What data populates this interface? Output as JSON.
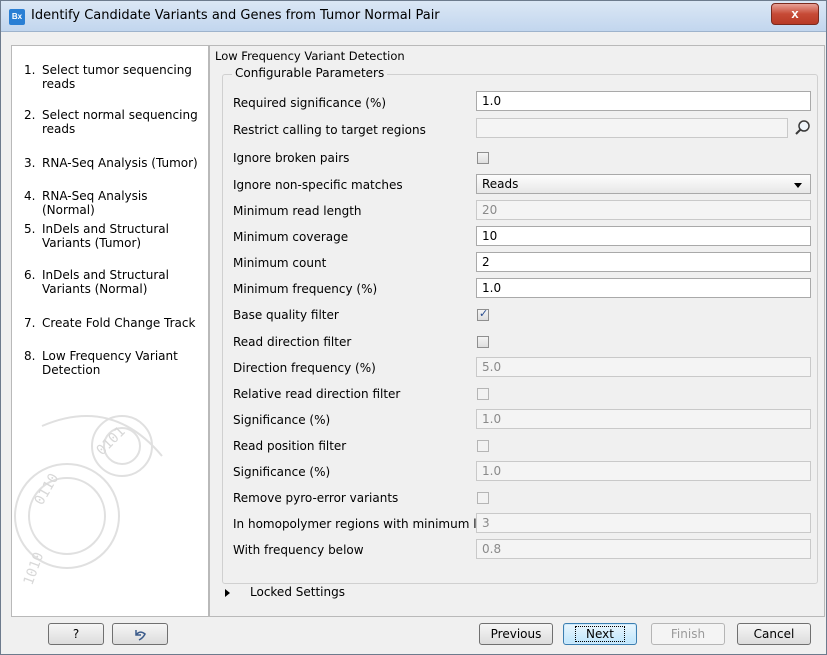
{
  "window": {
    "app_icon": "Bx",
    "title": "Identify Candidate Variants and Genes from Tumor Normal Pair",
    "close_label": "x"
  },
  "steps": [
    {
      "num": "1.",
      "label": "Select tumor sequencing reads"
    },
    {
      "num": "2.",
      "label": "Select normal sequencing reads"
    },
    {
      "num": "3.",
      "label": "RNA-Seq Analysis (Tumor)"
    },
    {
      "num": "4.",
      "label": "RNA-Seq Analysis (Normal)"
    },
    {
      "num": "5.",
      "label": "InDels and Structural Variants (Tumor)"
    },
    {
      "num": "6.",
      "label": "InDels and Structural Variants (Normal)"
    },
    {
      "num": "7.",
      "label": "Create Fold Change Track"
    },
    {
      "num": "8.",
      "label": "Low Frequency Variant Detection"
    }
  ],
  "panel": {
    "section_title": "Low Frequency Variant Detection",
    "group_title": "Configurable Parameters",
    "locked_settings": "Locked Settings",
    "params": {
      "required_significance": {
        "label": "Required significance (%)",
        "value": "1.0"
      },
      "restrict_calling": {
        "label": "Restrict calling to target regions",
        "value": ""
      },
      "ignore_broken_pairs": {
        "label": "Ignore broken pairs",
        "checked": false
      },
      "ignore_nonspecific": {
        "label": "Ignore non-specific matches",
        "value": "Reads"
      },
      "min_read_length": {
        "label": "Minimum read length",
        "value": "20"
      },
      "min_coverage": {
        "label": "Minimum coverage",
        "value": "10"
      },
      "min_count": {
        "label": "Minimum count",
        "value": "2"
      },
      "min_frequency": {
        "label": "Minimum frequency (%)",
        "value": "1.0"
      },
      "base_quality_filter": {
        "label": "Base quality filter",
        "checked": true
      },
      "read_direction_filter": {
        "label": "Read direction filter",
        "checked": false
      },
      "direction_frequency": {
        "label": "Direction frequency (%)",
        "value": "5.0"
      },
      "relative_read_direction_filter": {
        "label": "Relative read direction filter",
        "checked": false
      },
      "significance_1": {
        "label": "Significance (%)",
        "value": "1.0"
      },
      "read_position_filter": {
        "label": "Read position filter",
        "checked": false
      },
      "significance_2": {
        "label": "Significance (%)",
        "value": "1.0"
      },
      "remove_pyro": {
        "label": "Remove pyro-error variants",
        "checked": false
      },
      "homopolymer_min_length": {
        "label": "In homopolymer regions with minimum length",
        "value": "3"
      },
      "with_frequency_below": {
        "label": "With frequency below",
        "value": "0.8"
      }
    }
  },
  "footer": {
    "help_label": "?",
    "reset_icon": "reset-icon",
    "previous_label": "Previous",
    "next_label": "Next",
    "finish_label": "Finish",
    "cancel_label": "Cancel"
  }
}
